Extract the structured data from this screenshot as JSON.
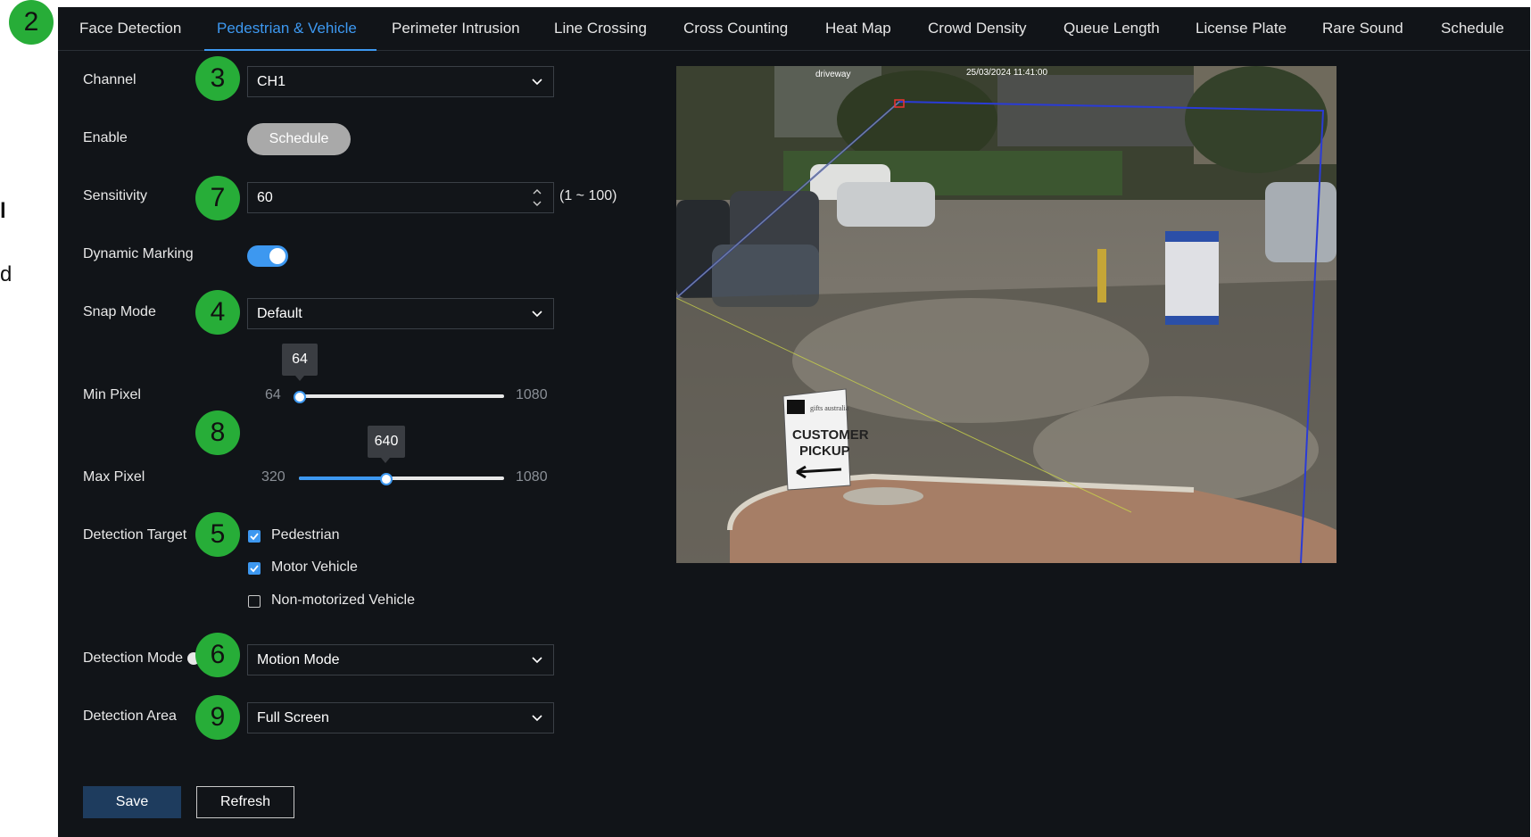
{
  "step_badges": {
    "tabs": "2",
    "channel": "3",
    "sensitivity": "7",
    "snap_mode": "4",
    "pixel": "8",
    "detection_target": "5",
    "detection_mode": "6",
    "detection_area": "9"
  },
  "edge_text": {
    "line1": "l",
    "line2": "d"
  },
  "tabs": [
    {
      "label": "Face Detection",
      "active": false
    },
    {
      "label": "Pedestrian & Vehicle",
      "active": true
    },
    {
      "label": "Perimeter Intrusion",
      "active": false
    },
    {
      "label": "Line Crossing",
      "active": false
    },
    {
      "label": "Cross Counting",
      "active": false
    },
    {
      "label": "Heat Map",
      "active": false
    },
    {
      "label": "Crowd Density",
      "active": false
    },
    {
      "label": "Queue Length",
      "active": false
    },
    {
      "label": "License Plate",
      "active": false
    },
    {
      "label": "Rare Sound",
      "active": false
    },
    {
      "label": "Schedule",
      "active": false
    }
  ],
  "form": {
    "channel": {
      "label": "Channel",
      "value": "CH1"
    },
    "enable": {
      "label": "Enable",
      "button": "Schedule"
    },
    "sensitivity": {
      "label": "Sensitivity",
      "value": "60",
      "range": "(1 ~ 100)"
    },
    "dynamic_marking": {
      "label": "Dynamic Marking",
      "on": true
    },
    "snap_mode": {
      "label": "Snap Mode",
      "value": "Default"
    },
    "min_pixel": {
      "label": "Min Pixel",
      "min": "64",
      "max": "1080",
      "value": "64",
      "fraction": 0.0
    },
    "max_pixel": {
      "label": "Max Pixel",
      "min": "320",
      "max": "1080",
      "value": "640",
      "fraction": 0.42
    },
    "detection_target": {
      "label": "Detection Target",
      "options": [
        {
          "label": "Pedestrian",
          "checked": true
        },
        {
          "label": "Motor Vehicle",
          "checked": true
        },
        {
          "label": "Non-motorized Vehicle",
          "checked": false
        }
      ]
    },
    "detection_mode": {
      "label": "Detection Mode",
      "value": "Motion Mode"
    },
    "detection_area": {
      "label": "Detection Area",
      "value": "Full Screen"
    }
  },
  "actions": {
    "save": "Save",
    "refresh": "Refresh"
  },
  "preview": {
    "osd_label": "driveway",
    "osd_time": "25/03/2024 11:41:00",
    "sign_top": "gifts australia",
    "sign_line1": "CUSTOMER",
    "sign_line2": "PICKUP"
  },
  "colors": {
    "accent": "#3d98f0",
    "badge": "#27ad38",
    "panel": "#111418",
    "zone_line": "#2a3bd6"
  }
}
